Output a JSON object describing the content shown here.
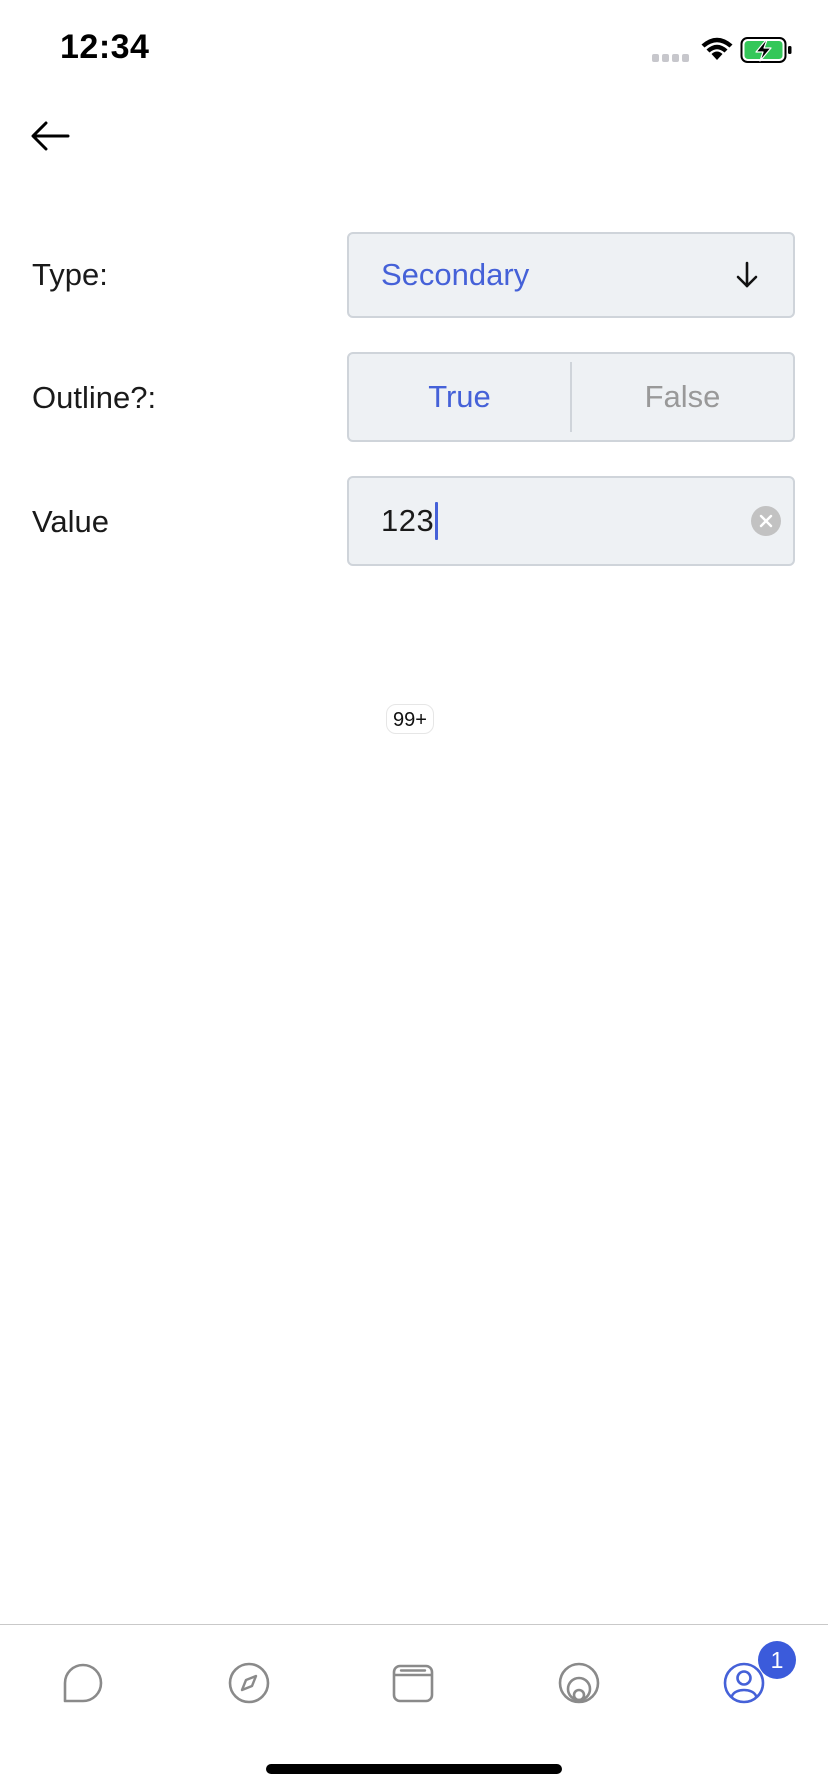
{
  "status_bar": {
    "time": "12:34"
  },
  "header": {
    "back_icon": "arrow-left-icon"
  },
  "form": {
    "type_label": "Type:",
    "type_value": "Secondary",
    "type_icon": "arrow-down-icon",
    "outline_label": "Outline?:",
    "outline_options": [
      "True",
      "False"
    ],
    "outline_selected": "True",
    "value_label": "Value",
    "value_input": "123",
    "clear_icon": "clear-icon"
  },
  "badge": {
    "text": "99+"
  },
  "tab_bar": {
    "tabs": [
      {
        "icon": "chat-bubble-icon"
      },
      {
        "icon": "compass-icon"
      },
      {
        "icon": "browser-window-icon"
      },
      {
        "icon": "circles-icon"
      },
      {
        "icon": "user-profile-icon"
      }
    ],
    "active_tab": 4,
    "badge_count": "1"
  },
  "colors": {
    "accent": "#4561d8",
    "field_background": "#eef1f4",
    "field_border": "#cfd4da",
    "inactive_text": "#999999",
    "tab_icon": "#8a8a8a",
    "badge_background": "#3b5bdb"
  }
}
